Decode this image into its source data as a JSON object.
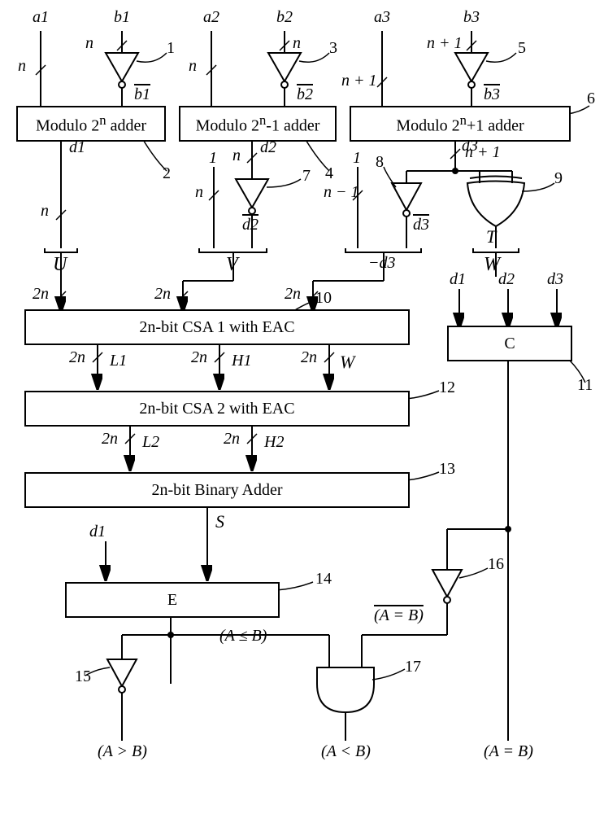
{
  "inputs": {
    "a1": "a1",
    "b1": "b1",
    "a2": "a2",
    "b2": "b2",
    "a3": "a3",
    "b3": "b3"
  },
  "widths": {
    "n": "n",
    "n1": "n",
    "nplus1": "n + 1",
    "nminus1": "n − 1",
    "two_n": "2n"
  },
  "inv_outputs": {
    "b1bar": "b1",
    "b2bar": "b2",
    "b3bar": "b3",
    "d2bar": "d2",
    "d3bar": "d3",
    "aEqBbar": "(A = B)"
  },
  "adders": {
    "mod2n": "Modulo 2",
    "mod2n_sup": "n",
    "mod2n_tail": " adder",
    "mod2n_1": "Modulo 2",
    "mod2n_1_sup": "n",
    "mod2n_1_tail": "-1 adder",
    "mod2n_p1": "Modulo 2",
    "mod2n_p1_sup": "n",
    "mod2n_p1_tail": "+1 adder",
    "csa1": "2n-bit CSA 1 with EAC",
    "csa2": "2n-bit CSA 2 with EAC",
    "bin": "2n-bit Binary Adder",
    "C": "C",
    "E": "E"
  },
  "sigs": {
    "d1": "d1",
    "d2": "d2",
    "d3": "d3",
    "U": "U",
    "V": "V",
    "W": "W",
    "T": "T",
    "L1": "L1",
    "H1": "H1",
    "W2": "W",
    "L2": "L2",
    "H2": "H2",
    "S": "S",
    "minus_d3": "−d3"
  },
  "ones": {
    "one": "1"
  },
  "refs": {
    "1": "1",
    "2": "2",
    "3": "3",
    "4": "4",
    "5": "5",
    "6": "6",
    "7": "7",
    "8": "8",
    "9": "9",
    "10": "10",
    "11": "11",
    "12": "12",
    "13": "13",
    "14": "14",
    "15": "15",
    "16": "16",
    "17": "17"
  },
  "results": {
    "agtb": "(A > B)",
    "aleb": "(A ≤ B)",
    "altb": "(A < B)",
    "aeqb": "(A = B)"
  }
}
